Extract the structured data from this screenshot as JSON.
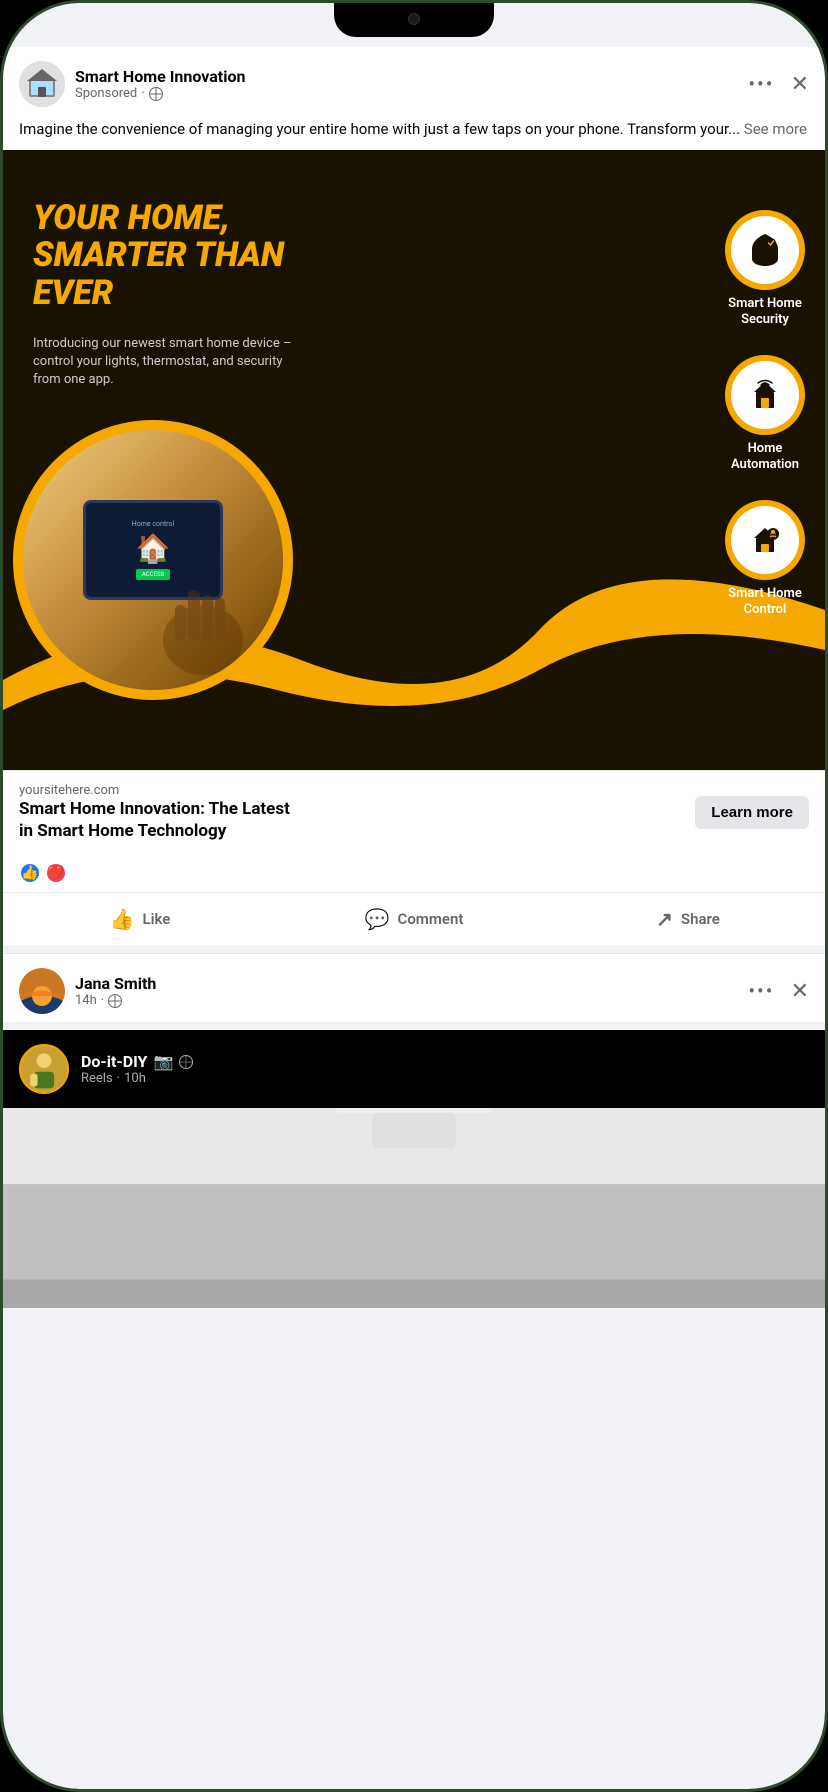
{
  "phone": {
    "background_color": "#1a2e1a"
  },
  "ad_post": {
    "page_name": "Smart Home Innovation",
    "sponsored_label": "Sponsored",
    "globe_label": "🌐",
    "post_text": "Imagine the convenience of managing your entire home with just a few taps on your phone. Transform your...",
    "see_more_label": "See more",
    "ad_headline_line1": "YOUR HOME,",
    "ad_headline_line2": "SMARTER THAN EVER",
    "ad_subtext": "Introducing our newest smart home device – control your lights, thermostat, and security from one app.",
    "features": [
      {
        "label": "Smart Home\nSecurity",
        "icon": "🏠"
      },
      {
        "label": "Home\nAutomation",
        "icon": "🏘"
      },
      {
        "label": "Smart Home\nControl",
        "icon": "🏡"
      }
    ],
    "site_url": "yoursitehere.com",
    "ad_title_line1": "Smart Home Innovation: The Latest",
    "ad_title_line2": "in Smart Home Technology",
    "learn_more_label": "Learn more",
    "reactions_count": "",
    "like_label": "Like",
    "comment_label": "Comment",
    "share_label": "Share",
    "dots_label": "•••",
    "close_label": "✕"
  },
  "second_post": {
    "user_name": "Jana Smith",
    "time": "14h",
    "globe_label": "🌐",
    "dots_label": "•••",
    "close_label": "✕"
  },
  "reel_post": {
    "page_name": "Do-it-DIY",
    "instagram_icon": "📷",
    "globe_icon": "🌐",
    "time": "10h",
    "reel_label": "Reels"
  }
}
